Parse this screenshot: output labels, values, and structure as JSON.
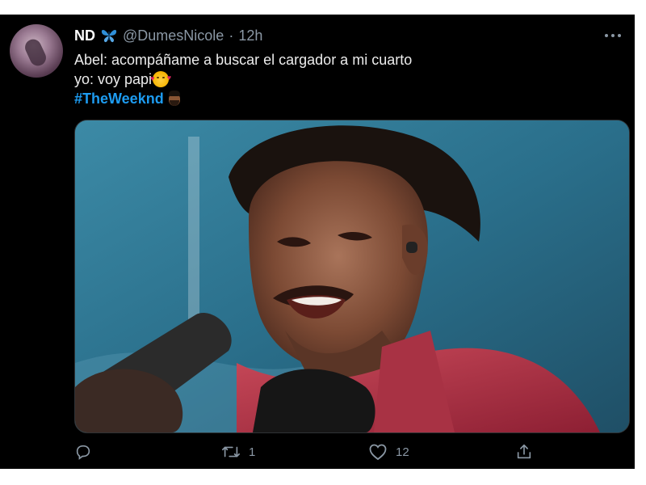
{
  "tweet": {
    "display_name": "ND",
    "handle": "@DumesNicole",
    "separator": "·",
    "time": "12h",
    "more_icon": "more-horizontal-icon",
    "verified_emoji": "blue-butterfly-icon",
    "lines": {
      "line1": "Abel: acompáñame a buscar el cargador a mi cuarto",
      "line2": "yo: voy papi",
      "hashtag": "#TheWeeknd"
    },
    "emojis": {
      "line2_emoji": "smiling-face-with-hearts-icon",
      "hashtag_emoji": "man-medium-dark-skin-beard-icon"
    },
    "media": {
      "alt": "The Weeknd winking into a microphone, red jacket"
    },
    "actions": {
      "reply": {
        "icon": "reply-icon",
        "count": ""
      },
      "retweet": {
        "icon": "retweet-icon",
        "count": "1"
      },
      "like": {
        "icon": "heart-icon",
        "count": "12"
      },
      "share": {
        "icon": "share-icon",
        "count": ""
      }
    }
  },
  "colors": {
    "background": "#000000",
    "hashtag": "#1d9bf0",
    "muted": "#8b98a5",
    "name": "#ffffff"
  }
}
